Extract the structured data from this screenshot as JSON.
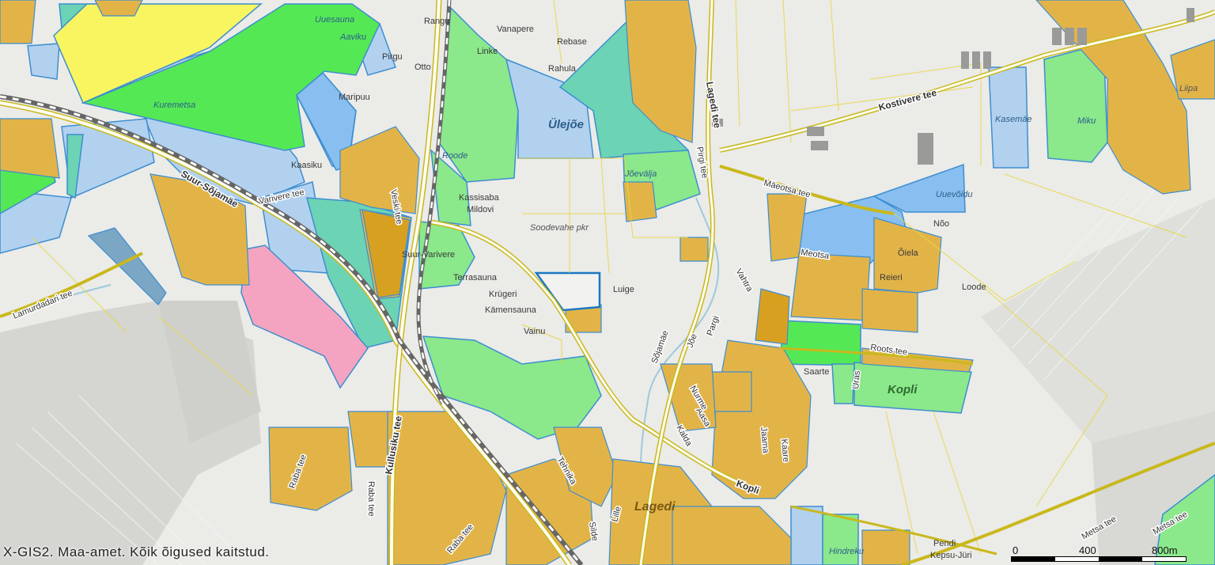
{
  "map": {
    "copyright": "X-GIS2. Maa-amet. Kõik õigused kaitstud.",
    "scale": {
      "labels": [
        "0",
        "400",
        "800m"
      ]
    },
    "area_labels": {
      "ulejoe": "Ülejõe",
      "kopli_big": "Kopli",
      "lagedi": "Lagedi",
      "soodevahe": "Soodevahe pkr"
    },
    "place_labels": {
      "uuesauna": "Uuesauna",
      "aaviku": "Aaviku",
      "rangu": "Rangu",
      "vanapere": "Vanapere",
      "rebase": "Rebase",
      "rahula": "Rahula",
      "linke": "Linke",
      "pirgu": "Pirgu",
      "otto": "Otto",
      "maripuu": "Maripuu",
      "kuremetsa": "Kuremetsa",
      "kaasiku": "Kaasiku",
      "roode": "Roode",
      "kassisaba": "Kassisaba",
      "mildovi": "Mildovi",
      "joevalja": "Jõevälja",
      "terrasauna": "Terrasauna",
      "krugeri": "Krügeri",
      "kamensauna": "Kämensauna",
      "vainu": "Vainu",
      "luige": "Luige",
      "kasemae": "Kasemäe",
      "miku": "Miku",
      "liipa": "Liipa",
      "uuevoidu": "Uuevõidu",
      "noo": "Nõo",
      "oiela": "Õiela",
      "reieri": "Reieri",
      "loode": "Loode",
      "saarte": "Saarte",
      "hindreku": "Hindreku",
      "pendi": "Pendi",
      "kepsu_jiiri": "Kepsu-Jüri",
      "suur_varivere": "Suur-Varivere"
    },
    "road_labels": {
      "kostivere_tee": "Kostivere tee",
      "lagedi_tee": "Lagedi tee",
      "parjgi_tee": "Pirgi tee",
      "maeotsa_tee": "Mäeotsa tee",
      "suur_sojamae": "Suur-Sõjamäe",
      "varivere_tee": "Varivere tee",
      "lamurdadari_tee": "Lamurdadari tee",
      "kullusiku_tee": "Kullusiku tee",
      "raba_tee_1": "Raba tee",
      "raba_tee_2": "Raba tee",
      "raba_tee_3": "Raba tee",
      "veski_tee": "Veski tee",
      "meotsa": "Meotsa",
      "roots_tee": "Roots tee",
      "uras": "Uras",
      "metsa_tee_1": "Metsa tee",
      "metsa_tee_2": "Metsa tee",
      "kopli_street": "Kopli",
      "kalda": "Kalda",
      "aasa": "Aasa",
      "nurme": "Nurme",
      "joe": "Jõe",
      "pargi": "Pargi",
      "vahtra": "Vahtra",
      "kaare": "Kaare",
      "lille": "Lille",
      "silde": "Silde",
      "tehnika": "Tehnika",
      "jaama": "Jaama",
      "sojamae_2": "Sõjamäe"
    }
  }
}
